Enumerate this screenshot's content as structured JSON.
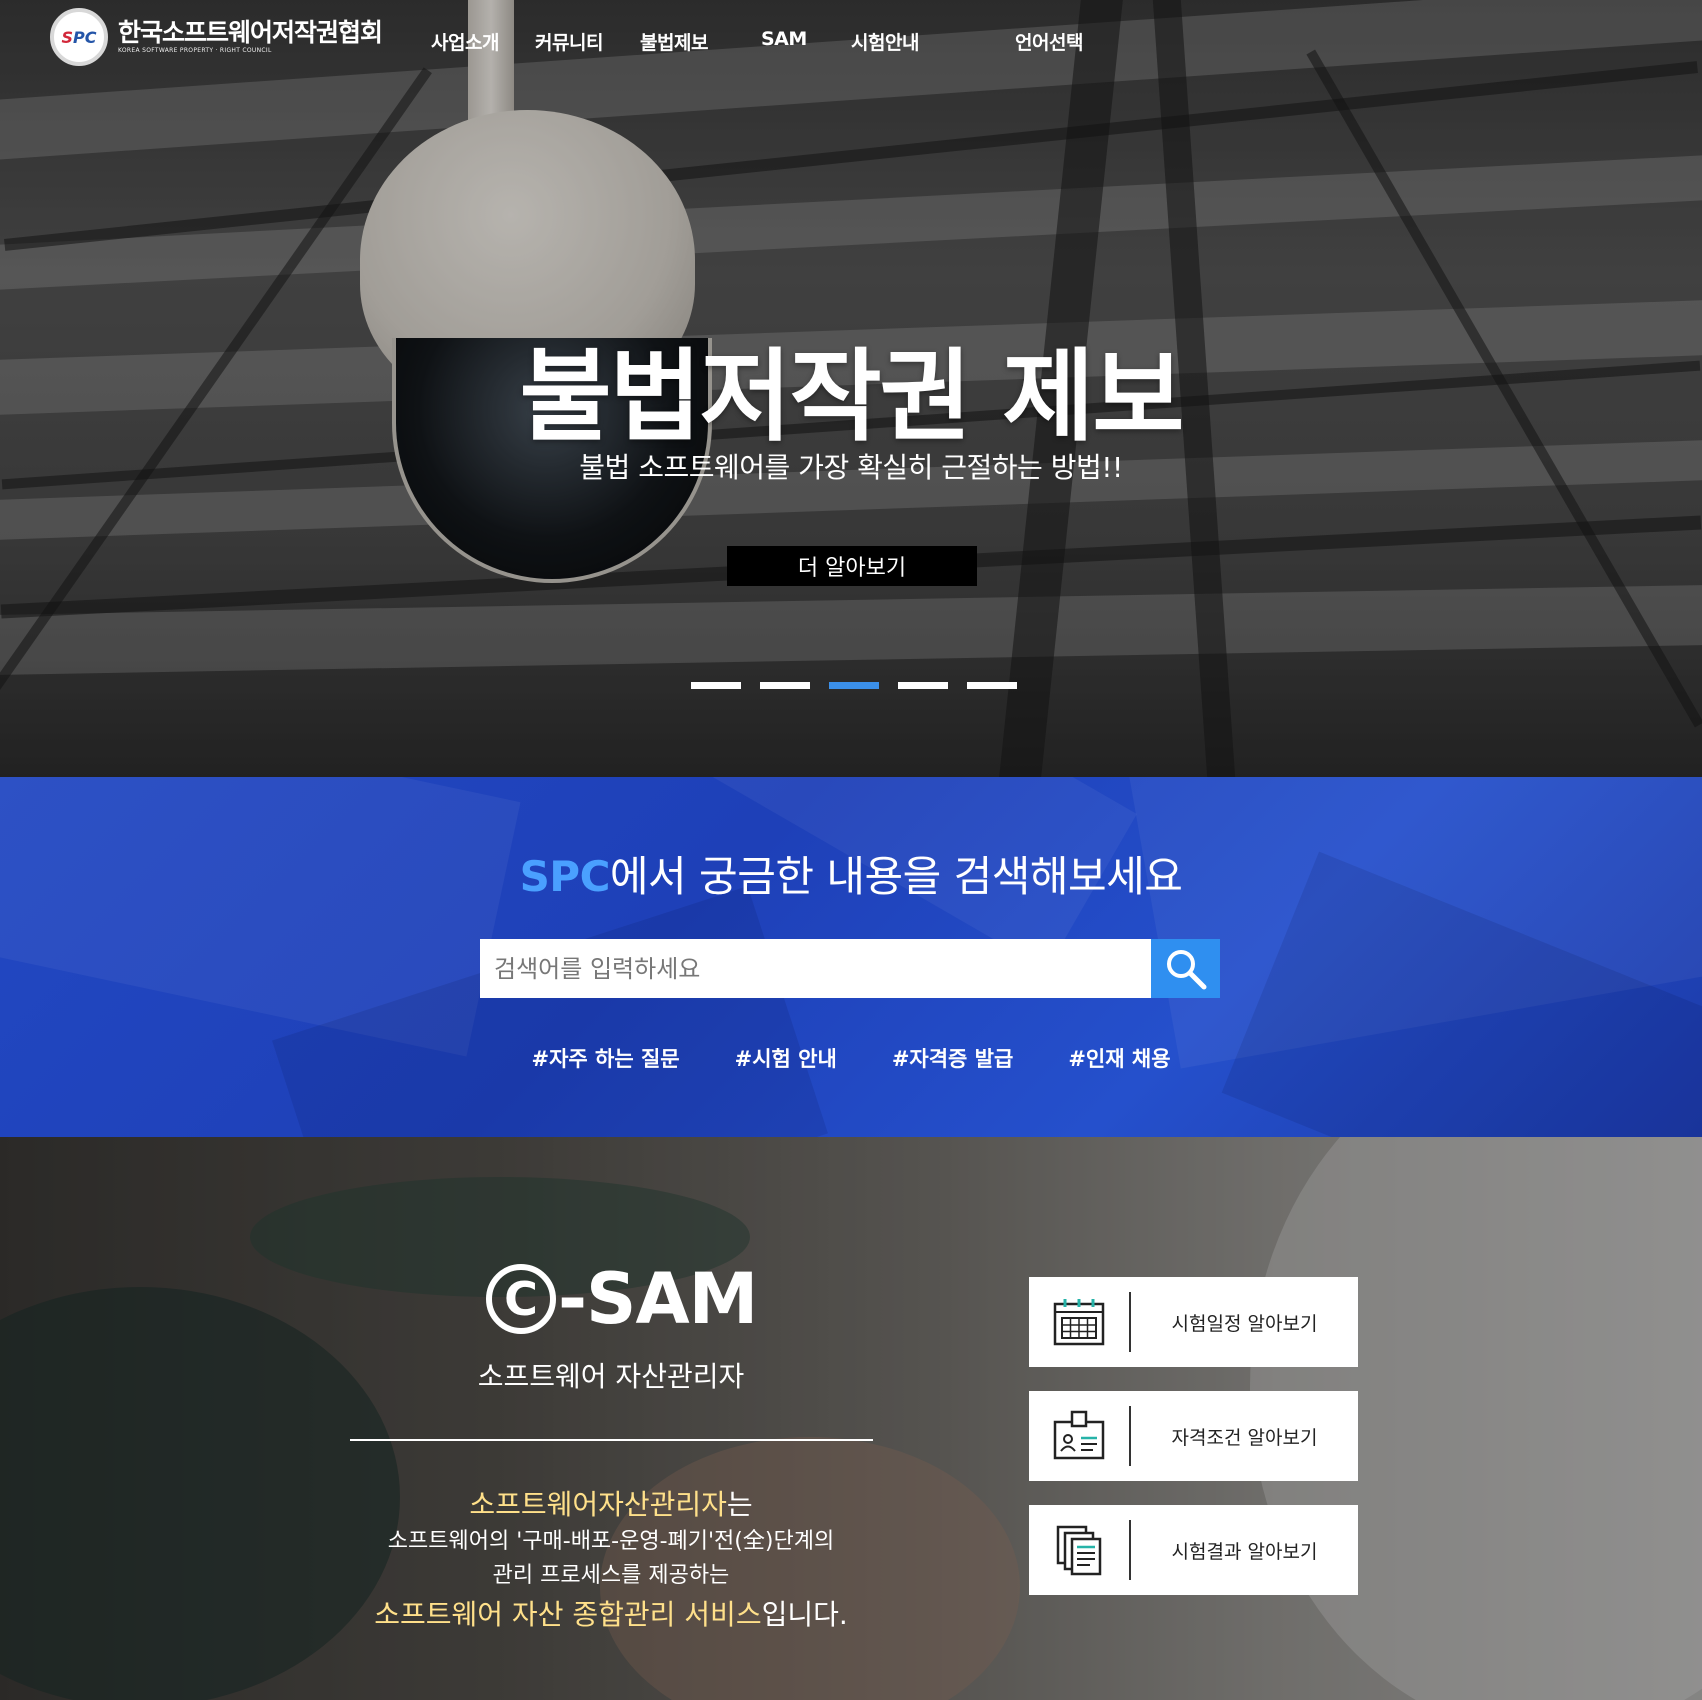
{
  "header": {
    "logo_text": "한국소프트웨어저작권협회",
    "logo_subtext": "KOREA SOFTWARE PROPERTY · RIGHT COUNCIL",
    "logo_emblem": "SPC",
    "menu": [
      {
        "label": "사업소개"
      },
      {
        "label": "커뮤니티"
      },
      {
        "label": "불법제보"
      },
      {
        "label": "SAM"
      },
      {
        "label": "시험안내"
      },
      {
        "label": "언어선택"
      }
    ]
  },
  "hero": {
    "title": "불법저작권 제보",
    "subtitle": "불법 소프트웨어를 가장 확실히 근절하는 방법!!",
    "button_label": "더 알아보기",
    "slide_count": 5,
    "active_slide": 3
  },
  "search": {
    "title_accent": "SPC",
    "title_rest": "에서 궁금한 내용을 검색해보세요",
    "placeholder": "검색어를 입력하세요",
    "tags": [
      "#자주 하는 질문",
      "#시험 안내",
      "#자격증 발급",
      "#인재 채용"
    ]
  },
  "csam": {
    "logo_c": "C",
    "logo_word": "-SAM",
    "subtitle": "소프트웨어 자산관리자",
    "desc_l1_highlight": "소프트웨어자산관리자",
    "desc_l1_rest": "는",
    "desc_l2": "소프트웨어의 '구매-배포-운영-폐기'전(全)단계의",
    "desc_l3": "관리 프로세스를 제공하는",
    "desc_l4_highlight": "소프트웨어 자산 종합관리 서비스",
    "desc_l4_rest": "입니다.",
    "cards": [
      {
        "label": "시험일정 알아보기",
        "icon": "calendar-icon"
      },
      {
        "label": "자격조건 알아보기",
        "icon": "id-card-icon"
      },
      {
        "label": "시험결과 알아보기",
        "icon": "documents-icon"
      }
    ]
  },
  "colors": {
    "accent_blue": "#2f8ff0",
    "search_bg": "#2248c2",
    "highlight_yellow": "#ffe08a",
    "active_dot": "#3b8fe8"
  }
}
